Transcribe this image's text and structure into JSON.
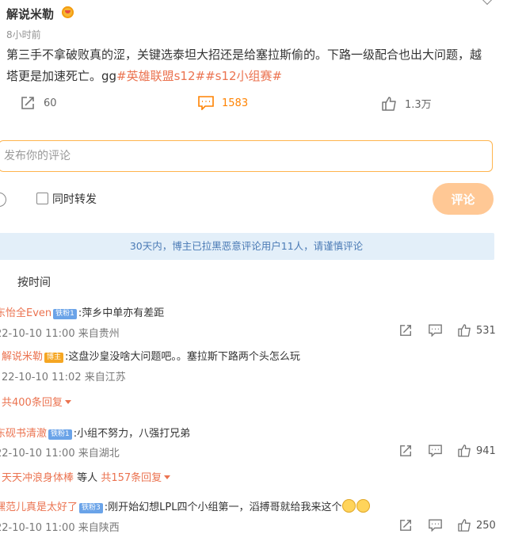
{
  "post": {
    "author": "解说米勒",
    "time": "8小时前",
    "content": "第三手不拿破败真的涩，关键选泰坦大招还是给塞拉斯偷的。下路一级配合也出大问题，越塔更是加速死亡。gg",
    "tags": "#英雄联盟s12##s12小组赛#",
    "actions": {
      "repost_count": "60",
      "comment_count": "1583",
      "like_count": "1.3万"
    }
  },
  "composer": {
    "placeholder": "发布你的评论",
    "repost_label": "同时转发",
    "submit_label": "评论"
  },
  "notice": "30天内，博主已拉黑恶意评论用户11人，请谨慎评论",
  "sort_label": "按时间",
  "comments": [
    {
      "name": "东怡全Even",
      "badge": "铁粉1",
      "text": ":萍乡中单亦有差距",
      "meta": "22-10-10 11:00 来自贵州",
      "likes": "531"
    },
    {
      "name": "解说米勒",
      "badge": "博主",
      "text": ":这盘沙皇没啥大问题吧。。塞拉斯下路两个头怎么玩",
      "meta": "22-10-10 11:02 来自江苏",
      "replies": "共400条回复"
    },
    {
      "name": "东砚书清澈",
      "badge": "铁粉1",
      "text": ":小组不努力，八强打兄弟",
      "meta": "22-10-10 11:00 来自湖北",
      "likes": "941",
      "sub_name": "天天冲浪身体棒",
      "sub_text": "等人",
      "replies": "共157条回复"
    },
    {
      "name": "嘿范儿真是太好了",
      "badge": "铁粉3",
      "text": ":刚开始幻想LPL四个小组第一，滔搏哥就给我来这个",
      "meta": "22-10-10 11:00 来自陕西",
      "likes": "250"
    }
  ],
  "colors": {
    "accent": "#ff8200",
    "tag": "#eb7350",
    "notice_bg": "#e3eff9",
    "submit_bg": "#ffc895"
  }
}
